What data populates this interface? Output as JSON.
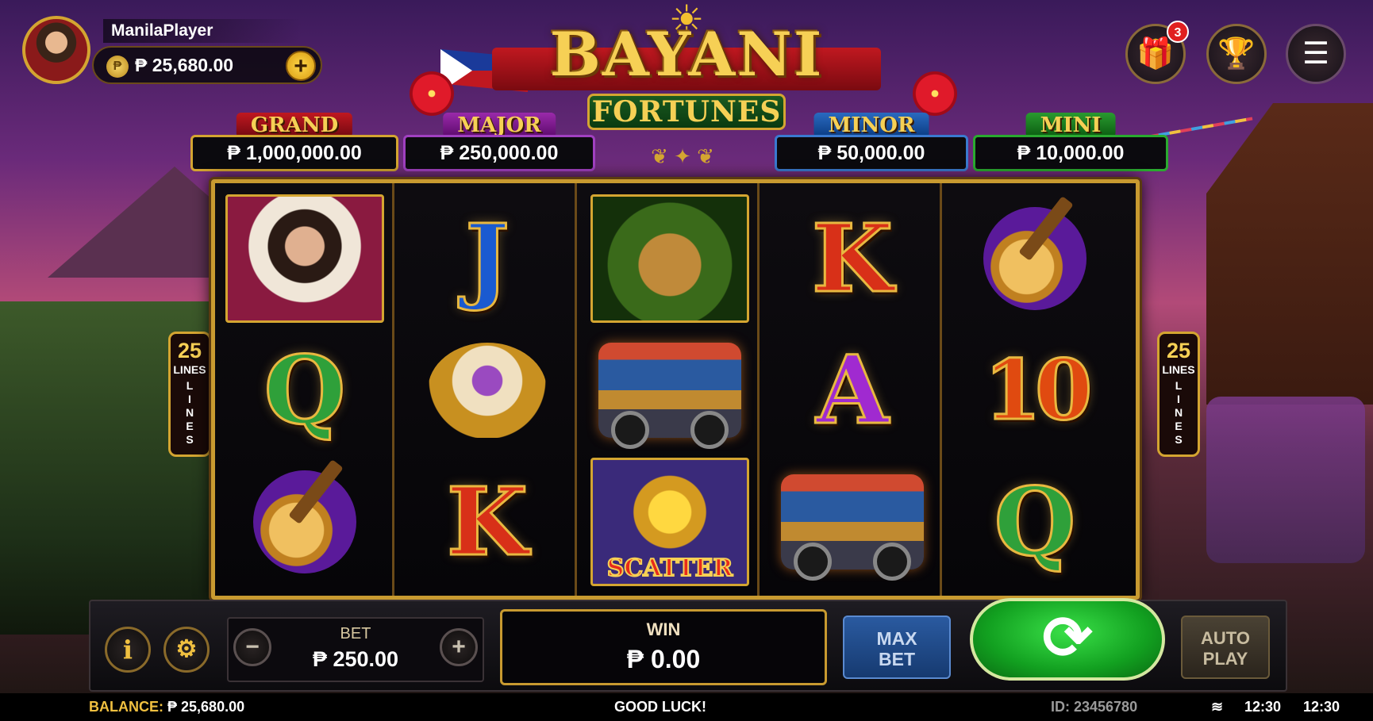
{
  "player": {
    "name": "ManilaPlayer",
    "balance": "₱ 25,680.00",
    "coin_icon": "coin-icon",
    "add_label": "+"
  },
  "header": {
    "gift_badge": "3",
    "gift_icon": "gift-icon",
    "trophy_icon": "trophy-icon",
    "menu_icon": "menu-icon"
  },
  "logo": {
    "line1": "BAYANI",
    "line2": "FORTUNES"
  },
  "jackpots": [
    {
      "label": "GRAND",
      "value": "₱ 1,000,000.00",
      "color": "#c01820"
    },
    {
      "label": "MAJOR",
      "value": "₱ 250,000.00",
      "color": "#9a2aaa"
    },
    {
      "label": "MINOR",
      "value": "₱ 50,000.00",
      "color": "#2a6ac0"
    },
    {
      "label": "MINI",
      "value": "₱ 10,000.00",
      "color": "#2a9a30"
    }
  ],
  "lines": {
    "count": "25",
    "label": "LINES"
  },
  "reels": [
    [
      "maria-clara-portrait",
      "Q",
      "bandurria-guitar"
    ],
    [
      "J",
      "halo-halo-dessert",
      "K"
    ],
    [
      "nipa-hut",
      "jeepney",
      "sun-scatter"
    ],
    [
      "K",
      "A",
      "jeepney"
    ],
    [
      "bandurria-guitar",
      "10",
      "Q"
    ]
  ],
  "symbols": {
    "scatter_label": "SCATTER"
  },
  "controls": {
    "bet_label": "BET",
    "bet_value": "₱ 250.00",
    "minus_label": "−",
    "plus_label": "+",
    "win_label": "WIN",
    "win_value": "₱ 0.00",
    "maxbet_label_1": "MAX",
    "maxbet_label_2": "BET",
    "autoplay_label_1": "AUTO",
    "autoplay_label_2": "PLAY",
    "info_label": "i",
    "spin_icon": "refresh-icon"
  },
  "status": {
    "balance_label": "BALANCE:",
    "balance_value": "₱ 25,680.00",
    "message": "GOOD LUCK!",
    "id": "ID: 23456780",
    "time1": "12:30",
    "time2": "12:30"
  },
  "colors": {
    "gold": "#d4a531",
    "spin_green": "#12a020",
    "accent_red": "#c01820"
  }
}
